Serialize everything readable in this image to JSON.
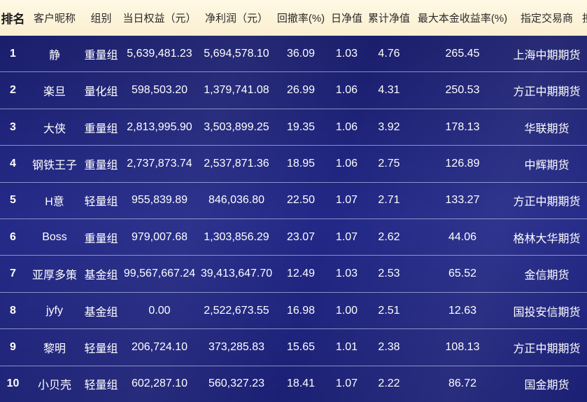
{
  "colors": {
    "header_bg": "#fbefd0",
    "header_text": "#2b2b2b",
    "body_bg": "#222887",
    "body_text": "#ffffff",
    "row_divider": "#e1e4ff"
  },
  "table": {
    "columns": [
      "排名",
      "客户昵称",
      "组别",
      "当日权益（元）",
      "净利润（元）",
      "回撤率(%)",
      "日净值",
      "累计净值",
      "最大本金收益率(%)",
      "指定交易商",
      "担"
    ],
    "rows": [
      {
        "rank": "1",
        "name": "静",
        "group": "重量组",
        "equity": "5,639,481.23",
        "net_profit": "5,694,578.10",
        "drawdown": "36.09",
        "daily_nav": "1.03",
        "cum_nav": "4.76",
        "max_return": "265.45",
        "broker": "上海中期期货"
      },
      {
        "rank": "2",
        "name": "楽旦",
        "group": "量化组",
        "equity": "598,503.20",
        "net_profit": "1,379,741.08",
        "drawdown": "26.99",
        "daily_nav": "1.06",
        "cum_nav": "4.31",
        "max_return": "250.53",
        "broker": "方正中期期货"
      },
      {
        "rank": "3",
        "name": "大侠",
        "group": "重量组",
        "equity": "2,813,995.90",
        "net_profit": "3,503,899.25",
        "drawdown": "19.35",
        "daily_nav": "1.06",
        "cum_nav": "3.92",
        "max_return": "178.13",
        "broker": "华联期货"
      },
      {
        "rank": "4",
        "name": "钢铁王子",
        "group": "重量组",
        "equity": "2,737,873.74",
        "net_profit": "2,537,871.36",
        "drawdown": "18.95",
        "daily_nav": "1.06",
        "cum_nav": "2.75",
        "max_return": "126.89",
        "broker": "中辉期货"
      },
      {
        "rank": "5",
        "name": "H意",
        "group": "轻量组",
        "equity": "955,839.89",
        "net_profit": "846,036.80",
        "drawdown": "22.50",
        "daily_nav": "1.07",
        "cum_nav": "2.71",
        "max_return": "133.27",
        "broker": "方正中期期货"
      },
      {
        "rank": "6",
        "name": "Boss",
        "group": "重量组",
        "equity": "979,007.68",
        "net_profit": "1,303,856.29",
        "drawdown": "23.07",
        "daily_nav": "1.07",
        "cum_nav": "2.62",
        "max_return": "44.06",
        "broker": "格林大华期货"
      },
      {
        "rank": "7",
        "name": "亚厚多策",
        "group": "基金组",
        "equity": "99,567,667.24",
        "net_profit": "39,413,647.70",
        "drawdown": "12.49",
        "daily_nav": "1.03",
        "cum_nav": "2.53",
        "max_return": "65.52",
        "broker": "金信期货"
      },
      {
        "rank": "8",
        "name": "jyfy",
        "group": "基金组",
        "equity": "0.00",
        "net_profit": "2,522,673.55",
        "drawdown": "16.98",
        "daily_nav": "1.00",
        "cum_nav": "2.51",
        "max_return": "12.63",
        "broker": "国投安信期货"
      },
      {
        "rank": "9",
        "name": "黎明",
        "group": "轻量组",
        "equity": "206,724.10",
        "net_profit": "373,285.83",
        "drawdown": "15.65",
        "daily_nav": "1.01",
        "cum_nav": "2.38",
        "max_return": "108.13",
        "broker": "方正中期期货"
      },
      {
        "rank": "10",
        "name": "小贝壳",
        "group": "轻量组",
        "equity": "602,287.10",
        "net_profit": "560,327.23",
        "drawdown": "18.41",
        "daily_nav": "1.07",
        "cum_nav": "2.22",
        "max_return": "86.72",
        "broker": "国金期货"
      }
    ]
  }
}
